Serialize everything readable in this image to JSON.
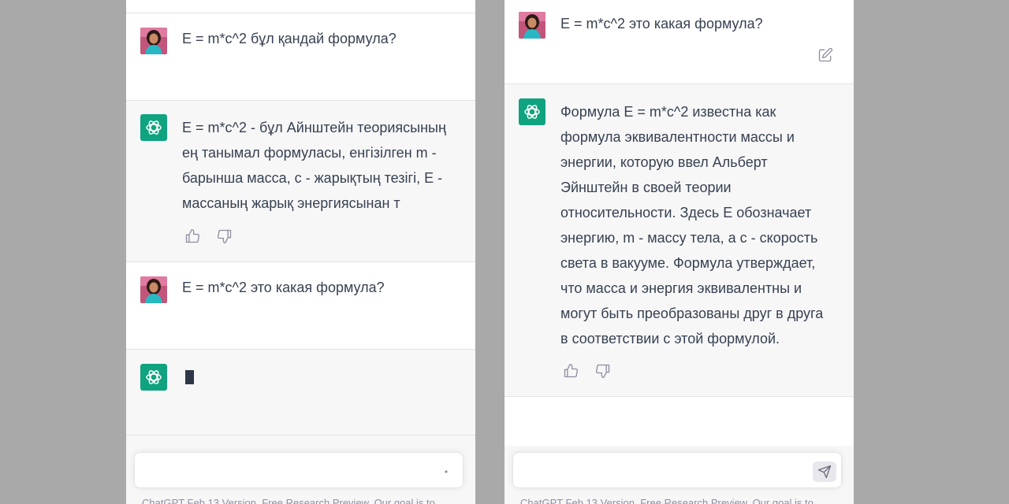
{
  "left": {
    "messages": [
      {
        "role": "user",
        "text": "E = m*c^2 бұл қандай формула?"
      },
      {
        "role": "assistant",
        "lines": [
          "E = m*c^2 - бұл Айнштейн теориясының",
          "ең танымал формуласы, енгізілген m -",
          "барынша масса, c - жарықтың тезігі, E -",
          "массаның жарық энергиясынан т"
        ]
      },
      {
        "role": "user",
        "text": "E = m*c^2 это какая формула?"
      },
      {
        "role": "assistant",
        "status": "typing"
      }
    ],
    "input_placeholder": "",
    "footer": "ChatGPT Feb 13 Version. Free Research Preview. Our goal is to"
  },
  "right": {
    "messages": [
      {
        "role": "user",
        "text": "E = m*c^2 это какая формула?"
      },
      {
        "role": "assistant",
        "lines": [
          "Формула E = m*c^2 известна как",
          "формула эквивалентности массы и",
          "энергии, которую ввел Альберт",
          "Эйнштейн в своей теории",
          "относительности. Здесь E обозначает",
          "энергию, m - массу тела, а c - скорость",
          "света в вакууме. Формула утверждает,",
          "что масса и энергия эквивалентны и",
          "могут быть преобразованы друг в друга",
          "в соответствии с этой формулой."
        ]
      }
    ],
    "input_placeholder": "",
    "footer": "ChatGPT Feb 13 Version. Free Research Preview. Our goal is to"
  },
  "icons": {
    "assistant_logo": "openai-logo-icon",
    "thumbs_up": "thumbs-up-icon",
    "thumbs_down": "thumbs-down-icon",
    "edit": "edit-icon",
    "send": "send-icon"
  },
  "colors": {
    "accent": "#10a37f",
    "background": "#a9a9a9",
    "user_bg": "#ffffff",
    "assistant_bg": "#f7f7f8",
    "text": "#374151"
  }
}
